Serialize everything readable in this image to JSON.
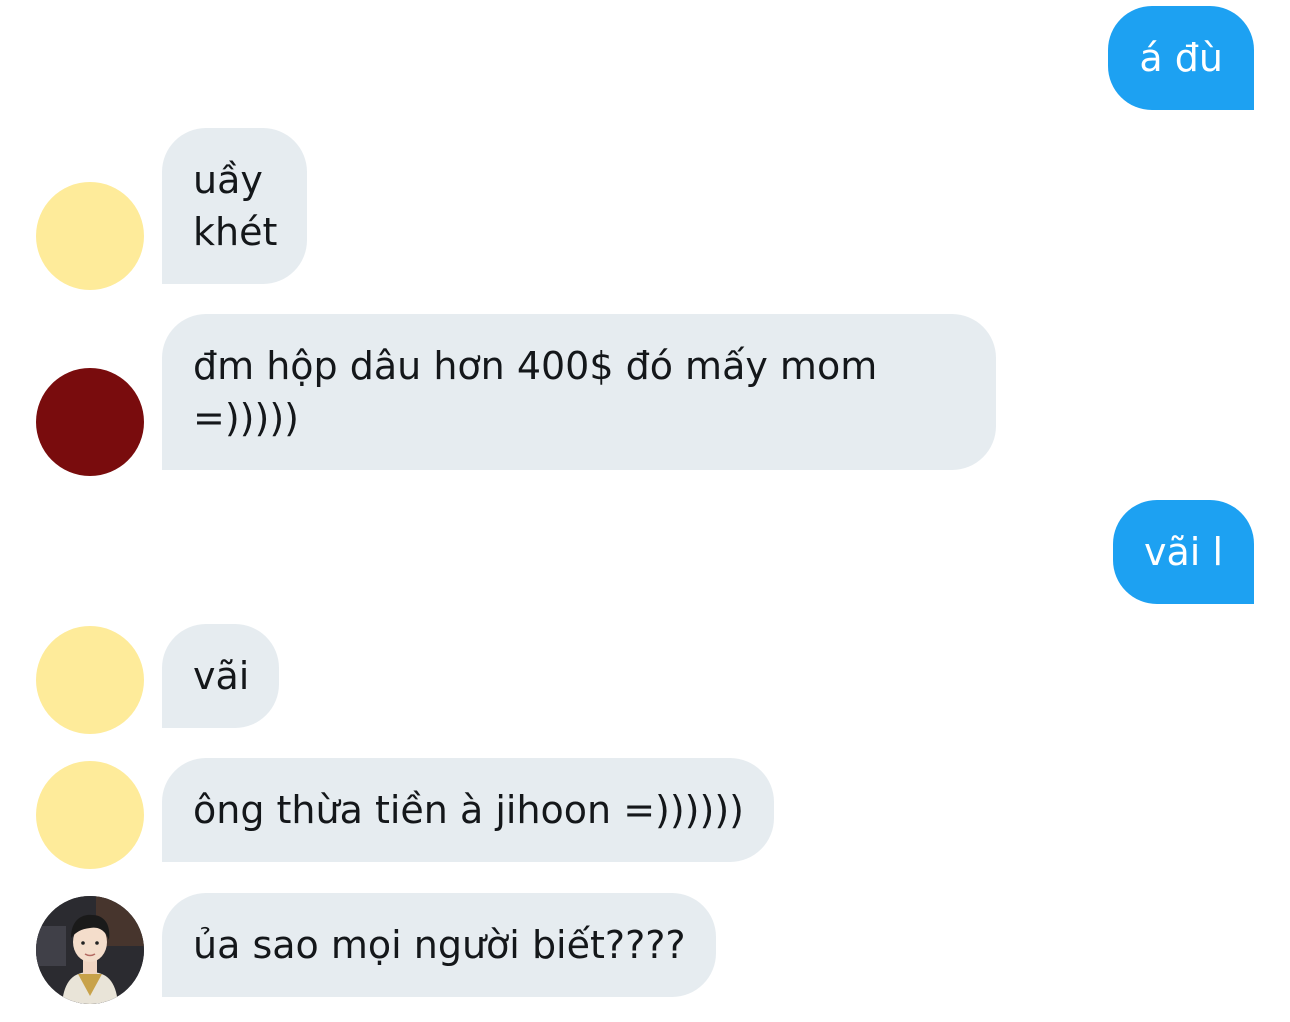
{
  "messages": [
    {
      "direction": "outgoing",
      "lines": [
        "á đù"
      ]
    },
    {
      "direction": "incoming",
      "avatar": "yellow-avatar",
      "lines": [
        "uầy",
        "khét"
      ]
    },
    {
      "direction": "incoming",
      "avatar": "dark-red-avatar",
      "lines": [
        "đm hộp dâu hơn 400$ đó mấy mom",
        "=)))))"
      ]
    },
    {
      "direction": "outgoing",
      "lines": [
        "vãi l"
      ]
    },
    {
      "direction": "incoming",
      "avatar": "yellow-avatar",
      "lines": [
        "vãi"
      ]
    },
    {
      "direction": "incoming",
      "avatar": "yellow-avatar",
      "lines": [
        "ông thừa tiền à jihoon =))))))"
      ]
    },
    {
      "direction": "incoming",
      "avatar": "profile-photo-avatar",
      "lines": [
        "ủa sao mọi người biết????"
      ]
    }
  ],
  "colors": {
    "incoming_bubble": "#e6ecf0",
    "outgoing_bubble": "#1da1f2",
    "yellow_avatar": "#feeb9a",
    "red_avatar": "#790c0d"
  }
}
